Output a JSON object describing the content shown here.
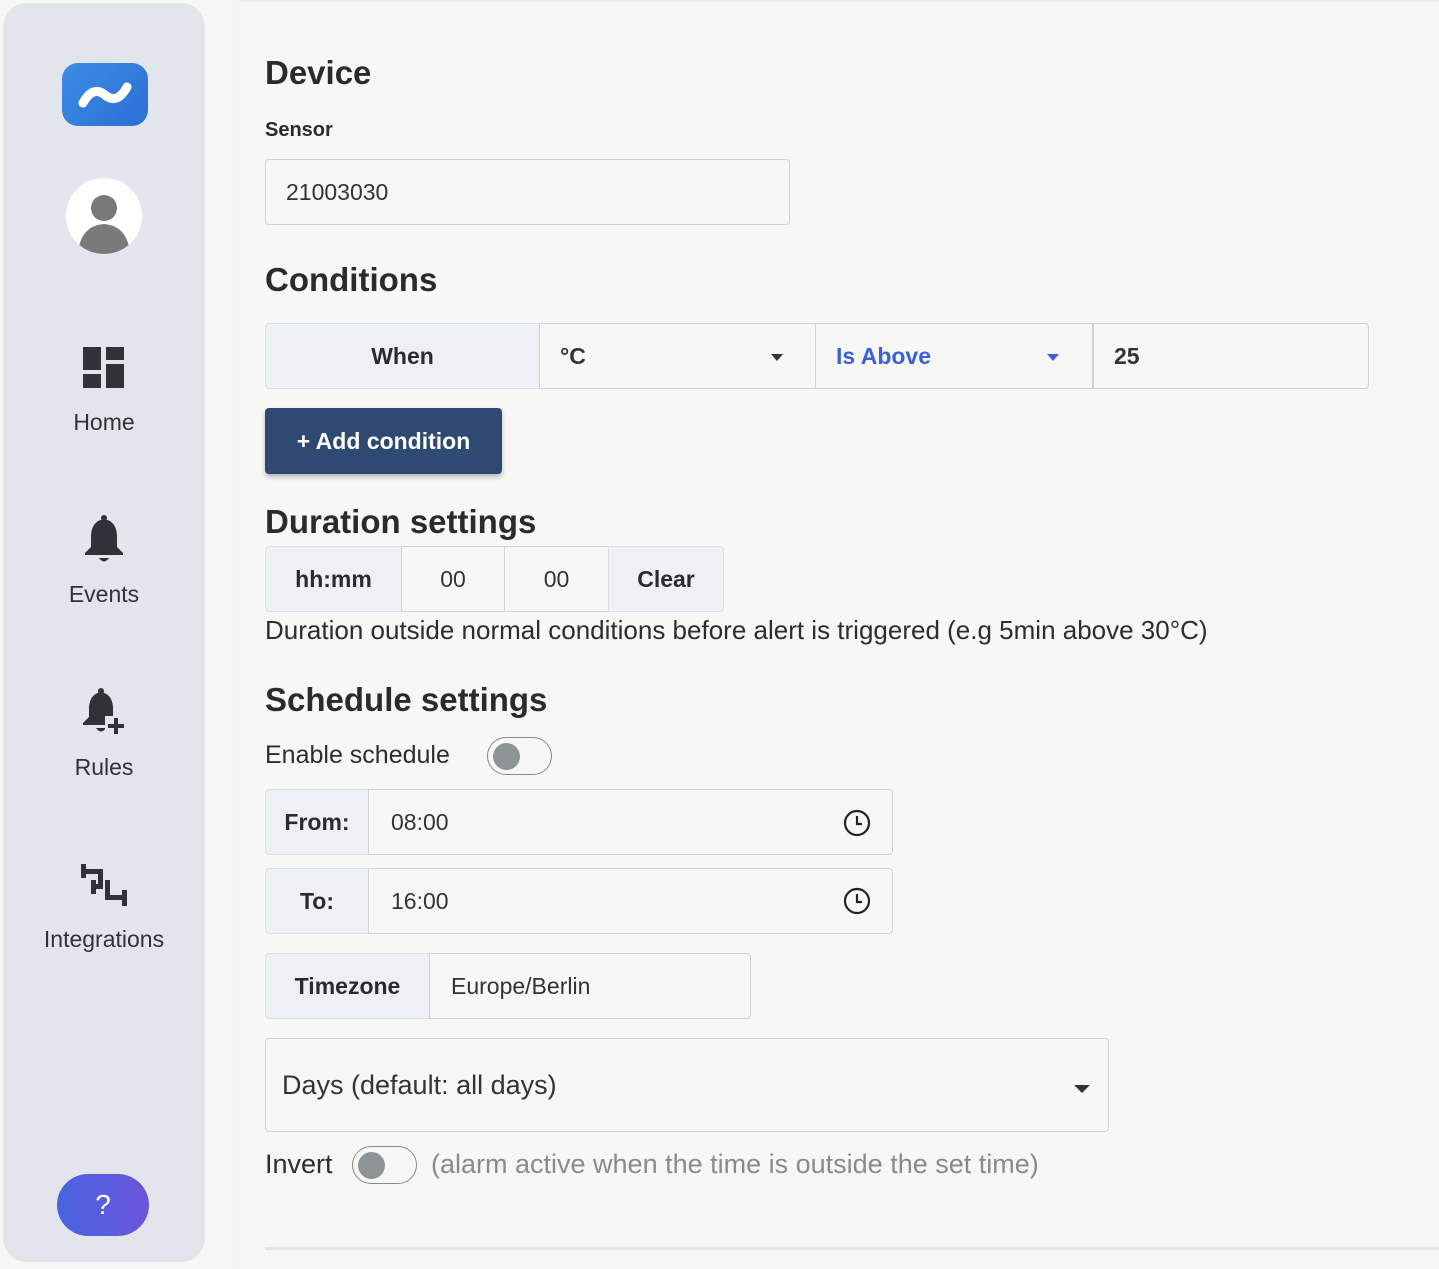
{
  "sidebar": {
    "nav": [
      {
        "label": "Home",
        "icon": "dashboard-icon"
      },
      {
        "label": "Events",
        "icon": "bell-icon"
      },
      {
        "label": "Rules",
        "icon": "bell-plus-icon"
      },
      {
        "label": "Integrations",
        "icon": "integrations-icon"
      }
    ],
    "help_label": "?"
  },
  "device": {
    "title": "Device",
    "sensor_label": "Sensor",
    "sensor_value": "21003030"
  },
  "conditions": {
    "title": "Conditions",
    "when_label": "When",
    "unit_value": "°C",
    "operator_value": "Is Above",
    "threshold_value": "25",
    "add_button_label": "+ Add condition"
  },
  "duration": {
    "title": "Duration settings",
    "format_label": "hh:mm",
    "hours_value": "00",
    "minutes_value": "00",
    "clear_label": "Clear",
    "help_text": "Duration outside normal conditions before alert is triggered (e.g 5min above 30°C)"
  },
  "schedule": {
    "title": "Schedule settings",
    "enable_label": "Enable schedule",
    "from_label": "From:",
    "from_value": "08:00",
    "to_label": "To:",
    "to_value": "16:00",
    "timezone_label": "Timezone",
    "timezone_value": "Europe/Berlin",
    "days_placeholder": "Days (default: all days)",
    "invert_label": "Invert",
    "invert_help": "(alarm active when the time is outside the set time)"
  },
  "colors": {
    "accent": "#2e4a73",
    "operator_text": "#3a62d6",
    "logo_blue": "#2f77dc",
    "help_gradient": [
      "#4a63e0",
      "#6a55dc"
    ]
  }
}
